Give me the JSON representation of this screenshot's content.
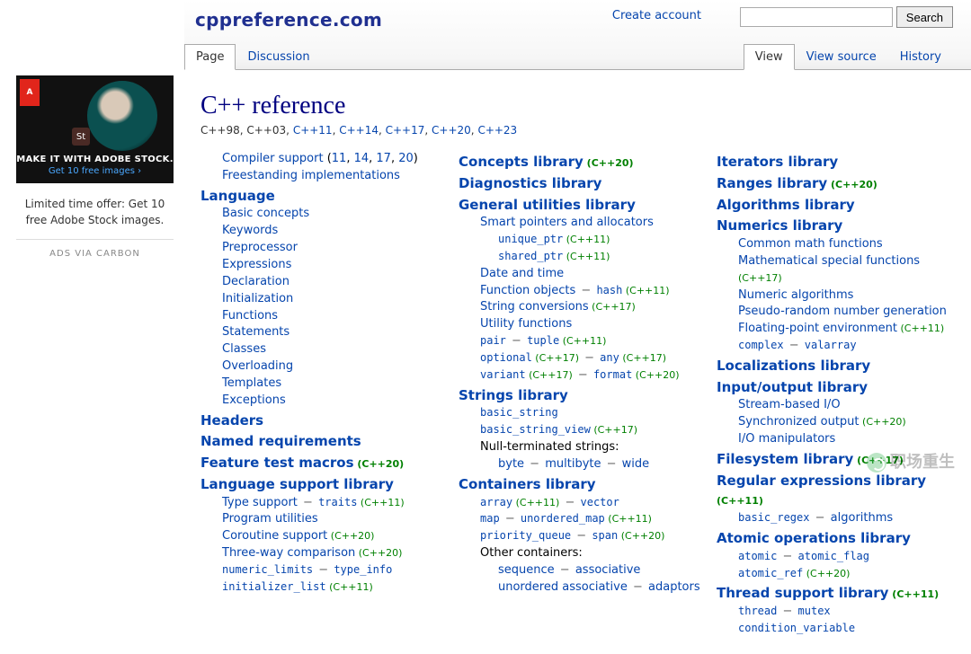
{
  "site_title": "cppreference.com",
  "account_link": "Create account",
  "search_button": "Search",
  "tabs_left": [
    "Page",
    "Discussion"
  ],
  "tabs_right": [
    "View",
    "View source",
    "History"
  ],
  "ad": {
    "badge": "A",
    "st": "St",
    "headline": "MAKE IT WITH ADOBE STOCK.",
    "sublink": "Get 10 free images ›",
    "text": "Limited time offer: Get 10 free Adobe Stock images.",
    "via": "ADS VIA CARBON"
  },
  "page_title": "C++ reference",
  "standards": [
    {
      "t": "C++98",
      "link": false
    },
    {
      "t": "C++03",
      "link": false
    },
    {
      "t": "C++11",
      "link": true
    },
    {
      "t": "C++14",
      "link": true
    },
    {
      "t": "C++17",
      "link": true
    },
    {
      "t": "C++20",
      "link": true
    },
    {
      "t": "C++23",
      "link": true
    }
  ],
  "col1": [
    {
      "cls": "lvl1",
      "parts": [
        {
          "t": "Compiler support",
          "a": 1
        },
        {
          "t": " (",
          "p": 1
        },
        {
          "t": "11",
          "a": 1
        },
        {
          "t": ", ",
          "p": 1
        },
        {
          "t": "14",
          "a": 1
        },
        {
          "t": ", ",
          "p": 1
        },
        {
          "t": "17",
          "a": 1
        },
        {
          "t": ", ",
          "p": 1
        },
        {
          "t": "20",
          "a": 1
        },
        {
          "t": ")",
          "p": 1
        }
      ]
    },
    {
      "cls": "lvl1",
      "parts": [
        {
          "t": "Freestanding implementations",
          "a": 1
        }
      ]
    },
    {
      "cls": "lvl0",
      "parts": [
        {
          "t": "Language",
          "a": 1
        }
      ]
    },
    {
      "cls": "lvl1",
      "parts": [
        {
          "t": "Basic concepts",
          "a": 1
        }
      ]
    },
    {
      "cls": "lvl1",
      "parts": [
        {
          "t": "Keywords",
          "a": 1
        }
      ]
    },
    {
      "cls": "lvl1",
      "parts": [
        {
          "t": "Preprocessor",
          "a": 1
        }
      ]
    },
    {
      "cls": "lvl1",
      "parts": [
        {
          "t": "Expressions",
          "a": 1
        }
      ]
    },
    {
      "cls": "lvl1",
      "parts": [
        {
          "t": "Declaration",
          "a": 1
        }
      ]
    },
    {
      "cls": "lvl1",
      "parts": [
        {
          "t": "Initialization",
          "a": 1
        }
      ]
    },
    {
      "cls": "lvl1",
      "parts": [
        {
          "t": "Functions",
          "a": 1
        }
      ]
    },
    {
      "cls": "lvl1",
      "parts": [
        {
          "t": "Statements",
          "a": 1
        }
      ]
    },
    {
      "cls": "lvl1",
      "parts": [
        {
          "t": "Classes",
          "a": 1
        }
      ]
    },
    {
      "cls": "lvl1",
      "parts": [
        {
          "t": "Overloading",
          "a": 1
        }
      ]
    },
    {
      "cls": "lvl1",
      "parts": [
        {
          "t": "Templates",
          "a": 1
        }
      ]
    },
    {
      "cls": "lvl1",
      "parts": [
        {
          "t": "Exceptions",
          "a": 1
        }
      ]
    },
    {
      "cls": "lvl0",
      "parts": [
        {
          "t": "Headers",
          "a": 1
        }
      ]
    },
    {
      "cls": "lvl0",
      "parts": [
        {
          "t": "Named requirements",
          "a": 1
        }
      ]
    },
    {
      "cls": "lvl0",
      "parts": [
        {
          "t": "Feature test macros",
          "a": 1
        },
        {
          "t": " (C++20)",
          "g": 1
        }
      ]
    },
    {
      "cls": "lvl0",
      "parts": [
        {
          "t": "Language support library",
          "a": 1
        }
      ]
    },
    {
      "cls": "lvl1",
      "parts": [
        {
          "t": "Type support",
          "a": 1
        },
        {
          "t": " − ",
          "d": 1
        },
        {
          "t": "traits",
          "c": 1
        },
        {
          "t": " (C++11)",
          "g": 1
        }
      ]
    },
    {
      "cls": "lvl1",
      "parts": [
        {
          "t": "Program utilities",
          "a": 1
        }
      ]
    },
    {
      "cls": "lvl1",
      "parts": [
        {
          "t": "Coroutine support",
          "a": 1
        },
        {
          "t": " (C++20)",
          "g": 1
        }
      ]
    },
    {
      "cls": "lvl1",
      "parts": [
        {
          "t": "Three-way comparison",
          "a": 1
        },
        {
          "t": " (C++20)",
          "g": 1
        }
      ]
    },
    {
      "cls": "lvl1",
      "parts": [
        {
          "t": "numeric_limits",
          "c": 1
        },
        {
          "t": " − ",
          "d": 1
        },
        {
          "t": "type_info",
          "c": 1
        }
      ]
    },
    {
      "cls": "lvl1",
      "parts": [
        {
          "t": "initializer_list",
          "c": 1
        },
        {
          "t": " (C++11)",
          "g": 1
        }
      ]
    }
  ],
  "col2": [
    {
      "cls": "lvl0",
      "parts": [
        {
          "t": "Concepts library",
          "a": 1
        },
        {
          "t": " (C++20)",
          "g": 1
        }
      ]
    },
    {
      "cls": "lvl0",
      "parts": [
        {
          "t": "Diagnostics library",
          "a": 1
        }
      ]
    },
    {
      "cls": "lvl0",
      "parts": [
        {
          "t": "General utilities library",
          "a": 1
        }
      ]
    },
    {
      "cls": "lvl1",
      "parts": [
        {
          "t": "Smart pointers and allocators",
          "a": 1
        }
      ]
    },
    {
      "cls": "lvl2",
      "parts": [
        {
          "t": "unique_ptr",
          "c": 1
        },
        {
          "t": " (C++11)",
          "g": 1
        }
      ]
    },
    {
      "cls": "lvl2",
      "parts": [
        {
          "t": "shared_ptr",
          "c": 1
        },
        {
          "t": " (C++11)",
          "g": 1
        }
      ]
    },
    {
      "cls": "lvl1",
      "parts": [
        {
          "t": "Date and time",
          "a": 1
        }
      ]
    },
    {
      "cls": "lvl1",
      "parts": [
        {
          "t": "Function objects",
          "a": 1
        },
        {
          "t": "  −  ",
          "d": 1
        },
        {
          "t": "hash",
          "c": 1
        },
        {
          "t": " (C++11)",
          "g": 1
        }
      ]
    },
    {
      "cls": "lvl1",
      "parts": [
        {
          "t": "String conversions",
          "a": 1
        },
        {
          "t": " (C++17)",
          "g": 1
        }
      ]
    },
    {
      "cls": "lvl1",
      "parts": [
        {
          "t": "Utility functions",
          "a": 1
        }
      ]
    },
    {
      "cls": "lvl1",
      "parts": [
        {
          "t": "pair",
          "c": 1
        },
        {
          "t": "  −  ",
          "d": 1
        },
        {
          "t": "tuple",
          "c": 1
        },
        {
          "t": " (C++11)",
          "g": 1
        }
      ]
    },
    {
      "cls": "lvl1",
      "parts": [
        {
          "t": "optional",
          "c": 1
        },
        {
          "t": " (C++17)",
          "g": 1
        },
        {
          "t": "  −  ",
          "d": 1
        },
        {
          "t": "any",
          "c": 1
        },
        {
          "t": " (C++17)",
          "g": 1
        }
      ]
    },
    {
      "cls": "lvl1",
      "parts": [
        {
          "t": "variant",
          "c": 1
        },
        {
          "t": " (C++17)",
          "g": 1
        },
        {
          "t": "  −  ",
          "d": 1
        },
        {
          "t": "format",
          "c": 1
        },
        {
          "t": " (C++20)",
          "g": 1
        }
      ]
    },
    {
      "cls": "lvl0",
      "parts": [
        {
          "t": "Strings library",
          "a": 1
        }
      ]
    },
    {
      "cls": "lvl1",
      "parts": [
        {
          "t": "basic_string",
          "c": 1
        }
      ]
    },
    {
      "cls": "lvl1",
      "parts": [
        {
          "t": "basic_string_view",
          "c": 1
        },
        {
          "t": " (C++17)",
          "g": 1
        }
      ]
    },
    {
      "cls": "lvl1",
      "parts": [
        {
          "t": "Null-terminated strings:",
          "p": 1
        }
      ]
    },
    {
      "cls": "lvl2",
      "parts": [
        {
          "t": "byte",
          "a": 1
        },
        {
          "t": "  −  ",
          "d": 1
        },
        {
          "t": "multibyte",
          "a": 1
        },
        {
          "t": "  −  ",
          "d": 1
        },
        {
          "t": "wide",
          "a": 1
        }
      ]
    },
    {
      "cls": "lvl0",
      "parts": [
        {
          "t": "Containers library",
          "a": 1
        }
      ]
    },
    {
      "cls": "lvl1",
      "parts": [
        {
          "t": "array",
          "c": 1
        },
        {
          "t": " (C++11)",
          "g": 1
        },
        {
          "t": "  −  ",
          "d": 1
        },
        {
          "t": "vector",
          "c": 1
        }
      ]
    },
    {
      "cls": "lvl1",
      "parts": [
        {
          "t": "map",
          "c": 1
        },
        {
          "t": "  −  ",
          "d": 1
        },
        {
          "t": "unordered_map",
          "c": 1
        },
        {
          "t": " (C++11)",
          "g": 1
        }
      ]
    },
    {
      "cls": "lvl1",
      "parts": [
        {
          "t": "priority_queue",
          "c": 1
        },
        {
          "t": "  −  ",
          "d": 1
        },
        {
          "t": "span",
          "c": 1
        },
        {
          "t": " (C++20)",
          "g": 1
        }
      ]
    },
    {
      "cls": "lvl1",
      "parts": [
        {
          "t": "Other containers:",
          "p": 1
        }
      ]
    },
    {
      "cls": "lvl2",
      "parts": [
        {
          "t": "sequence",
          "a": 1
        },
        {
          "t": "  −  ",
          "d": 1
        },
        {
          "t": "associative",
          "a": 1
        }
      ]
    },
    {
      "cls": "lvl2",
      "parts": [
        {
          "t": "unordered associative",
          "a": 1
        },
        {
          "t": "  −  ",
          "d": 1
        },
        {
          "t": "adaptors",
          "a": 1
        }
      ]
    }
  ],
  "col3": [
    {
      "cls": "lvl0",
      "parts": [
        {
          "t": "Iterators library",
          "a": 1
        }
      ]
    },
    {
      "cls": "lvl0",
      "parts": [
        {
          "t": "Ranges library",
          "a": 1
        },
        {
          "t": " (C++20)",
          "g": 1
        }
      ]
    },
    {
      "cls": "lvl0",
      "parts": [
        {
          "t": "Algorithms library",
          "a": 1
        }
      ]
    },
    {
      "cls": "lvl0",
      "parts": [
        {
          "t": "Numerics library",
          "a": 1
        }
      ]
    },
    {
      "cls": "lvl1",
      "parts": [
        {
          "t": "Common math functions",
          "a": 1
        }
      ]
    },
    {
      "cls": "lvl1",
      "parts": [
        {
          "t": "Mathematical special functions",
          "a": 1
        },
        {
          "t": " (C++17)",
          "g": 1
        }
      ]
    },
    {
      "cls": "lvl1",
      "parts": [
        {
          "t": "Numeric algorithms",
          "a": 1
        }
      ]
    },
    {
      "cls": "lvl1",
      "parts": [
        {
          "t": "Pseudo-random number generation",
          "a": 1
        }
      ]
    },
    {
      "cls": "lvl1",
      "parts": [
        {
          "t": "Floating-point environment",
          "a": 1
        },
        {
          "t": " (C++11)",
          "g": 1
        }
      ]
    },
    {
      "cls": "lvl1",
      "parts": [
        {
          "t": "complex",
          "c": 1
        },
        {
          "t": "  −  ",
          "d": 1
        },
        {
          "t": "valarray",
          "c": 1
        }
      ]
    },
    {
      "cls": "lvl0",
      "parts": [
        {
          "t": "Localizations library",
          "a": 1
        }
      ]
    },
    {
      "cls": "lvl0",
      "parts": [
        {
          "t": "Input/output library",
          "a": 1
        }
      ]
    },
    {
      "cls": "lvl1",
      "parts": [
        {
          "t": "Stream-based I/O",
          "a": 1
        }
      ]
    },
    {
      "cls": "lvl1",
      "parts": [
        {
          "t": "Synchronized output",
          "a": 1
        },
        {
          "t": " (C++20)",
          "g": 1
        }
      ]
    },
    {
      "cls": "lvl1",
      "parts": [
        {
          "t": "I/O manipulators",
          "a": 1
        }
      ]
    },
    {
      "cls": "lvl0",
      "parts": [
        {
          "t": "Filesystem library",
          "a": 1
        },
        {
          "t": " (C++17)",
          "g": 1
        }
      ]
    },
    {
      "cls": "lvl0",
      "parts": [
        {
          "t": "Regular expressions library",
          "a": 1
        },
        {
          "t": " (C++11)",
          "g": 1
        }
      ]
    },
    {
      "cls": "lvl1",
      "parts": [
        {
          "t": "basic_regex",
          "c": 1
        },
        {
          "t": "  −  ",
          "d": 1
        },
        {
          "t": "algorithms",
          "a": 1
        }
      ]
    },
    {
      "cls": "lvl0",
      "parts": [
        {
          "t": "Atomic operations library",
          "a": 1
        }
      ]
    },
    {
      "cls": "lvl1",
      "parts": [
        {
          "t": "atomic",
          "c": 1
        },
        {
          "t": "  −  ",
          "d": 1
        },
        {
          "t": "atomic_flag",
          "c": 1
        }
      ]
    },
    {
      "cls": "lvl1",
      "parts": [
        {
          "t": "atomic_ref",
          "c": 1
        },
        {
          "t": " (C++20)",
          "g": 1
        }
      ]
    },
    {
      "cls": "lvl0",
      "parts": [
        {
          "t": "Thread support library",
          "a": 1
        },
        {
          "t": " (C++11)",
          "g": 1
        }
      ]
    },
    {
      "cls": "lvl1",
      "parts": [
        {
          "t": "thread",
          "c": 1
        },
        {
          "t": "  −  ",
          "d": 1
        },
        {
          "t": "mutex",
          "c": 1
        }
      ]
    },
    {
      "cls": "lvl1",
      "parts": [
        {
          "t": "condition_variable",
          "c": 1
        }
      ]
    }
  ],
  "watermark": "职场重生"
}
